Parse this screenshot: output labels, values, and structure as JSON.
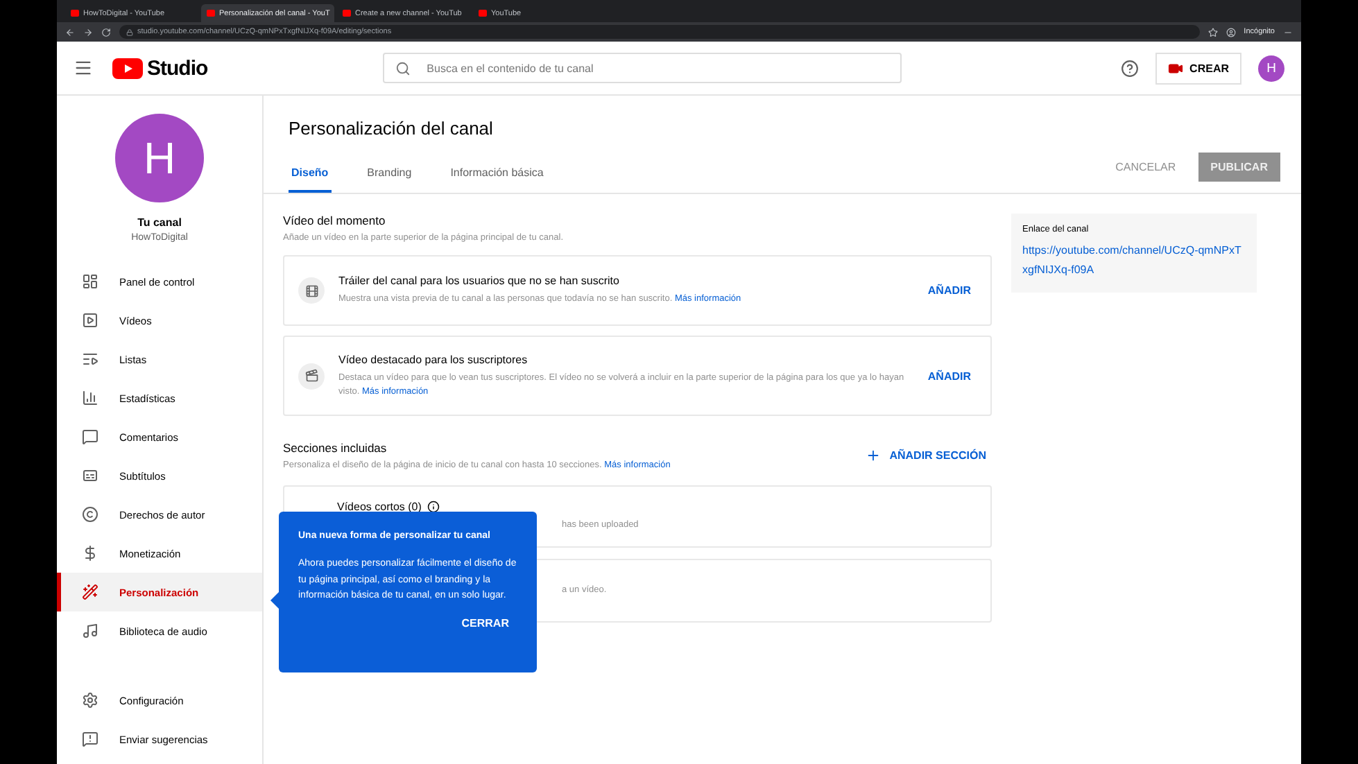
{
  "browser": {
    "tabs": [
      {
        "title": "HowToDigital - YouTube",
        "selected": false
      },
      {
        "title": "Personalización del canal - YouT",
        "selected": true
      },
      {
        "title": "Create a new channel - YouTub",
        "selected": false
      },
      {
        "title": "YouTube",
        "selected": false
      }
    ],
    "address": "studio.youtube.com/channel/UCzQ-qmNPxTxgfNIJXq-f09A/editing/sections",
    "profile": "Incógnito"
  },
  "header": {
    "logo": "Studio",
    "search_placeholder": "Busca en el contenido de tu canal",
    "create_label": "CREAR",
    "avatar": "H"
  },
  "sidebar": {
    "avatar": "H",
    "channel_title": "Tu canal",
    "channel_name": "HowToDigital",
    "items": [
      {
        "label": "Panel de control",
        "selected": false
      },
      {
        "label": "Vídeos",
        "selected": false
      },
      {
        "label": "Listas",
        "selected": false
      },
      {
        "label": "Estadísticas",
        "selected": false
      },
      {
        "label": "Comentarios",
        "selected": false
      },
      {
        "label": "Subtítulos",
        "selected": false
      },
      {
        "label": "Derechos de autor",
        "selected": false
      },
      {
        "label": "Monetización",
        "selected": false
      },
      {
        "label": "Personalización",
        "selected": true
      },
      {
        "label": "Biblioteca de audio",
        "selected": false
      }
    ],
    "bottom_items": [
      {
        "label": "Configuración"
      },
      {
        "label": "Enviar sugerencias"
      }
    ]
  },
  "page": {
    "title": "Personalización del canal",
    "tabs": [
      {
        "label": "Diseño",
        "selected": true
      },
      {
        "label": "Branding",
        "selected": false
      },
      {
        "label": "Información básica",
        "selected": false
      }
    ],
    "cancel": "CANCELAR",
    "publish": "PUBLICAR"
  },
  "featured": {
    "title": "Vídeo del momento",
    "description": "Añade un vídeo en la parte superior de la página principal de tu canal.",
    "cards": [
      {
        "title": "Tráiler del canal para los usuarios que no se han suscrito",
        "description": "Muestra una vista previa de tu canal a las personas que todavía no se han suscrito.",
        "link": "Más información",
        "action": "AÑADIR"
      },
      {
        "title": "Vídeo destacado para los suscriptores",
        "description": "Destaca un vídeo para que lo vean tus suscriptores. El vídeo no se volverá a incluir en la parte superior de la página para los que ya lo hayan visto.",
        "link": "Más información",
        "action": "AÑADIR"
      }
    ]
  },
  "sections": {
    "title": "Secciones incluidas",
    "description": "Personaliza el diseño de la página de inicio de tu canal con hasta 10 secciones.",
    "link": "Más información",
    "add": "AÑADIR SECCIÓN",
    "cards": [
      {
        "title": "Vídeos cortos (0)",
        "description": "has been uploaded"
      },
      {
        "description": "a un vídeo."
      }
    ]
  },
  "channel_link": {
    "label": "Enlace del canal",
    "url": "https://youtube.com/channel/UCzQ-qmNPxTxgfNIJXq-f09A"
  },
  "tooltip": {
    "title": "Una nueva forma de personalizar tu canal",
    "body": "Ahora puedes personalizar fácilmente el diseño de tu página principal, así como el branding y la información básica de tu canal, en un solo lugar.",
    "button": "CERRAR"
  }
}
